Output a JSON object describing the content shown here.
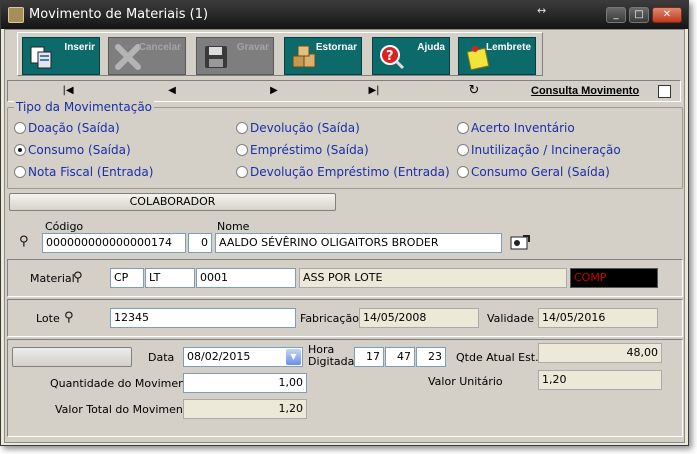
{
  "window": {
    "title": "Movimento de Materiais (1)",
    "resize_glyph": "↔",
    "minimize": "_",
    "maximize": "□",
    "close": "✕"
  },
  "toolbar": [
    {
      "label": "Inserir",
      "icon": "copy-document-icon",
      "enabled": true
    },
    {
      "label": "Cancelar",
      "icon": "cancel-x-icon",
      "enabled": false
    },
    {
      "label": "Gravar",
      "icon": "floppy-disk-icon",
      "enabled": false
    },
    {
      "label": "Estornar",
      "icon": "boxes-icon",
      "enabled": true
    },
    {
      "label": "Ajuda",
      "icon": "help-magnifier-icon",
      "enabled": true
    },
    {
      "label": "Lembrete",
      "icon": "sticky-note-icon",
      "enabled": true
    }
  ],
  "nav": {
    "first": "|◀",
    "prev": "◀",
    "next": "▶",
    "last": "▶|",
    "refresh": "↻",
    "consulta": "Consulta Movimento"
  },
  "tipo": {
    "legend": "Tipo da Movimentação",
    "options": [
      "Doação (Saída)",
      "Devolução (Saída)",
      "Acerto Inventário",
      "Consumo (Saída)",
      "Empréstimo (Saída)",
      "Inutilização / Incineração",
      "Nota Fiscal (Entrada)",
      "Devolução Empréstimo (Entrada)",
      "Consumo Geral (Saída)"
    ],
    "selected": "Consumo (Saída)"
  },
  "colaborador": {
    "section_label": "COLABORADOR",
    "codigo_label": "Código",
    "codigo": "000000000000000174",
    "codigo_digit": "0",
    "nome_label": "Nome",
    "nome": "AALDO SÉVÊRINO OLIGAITORS BRODER"
  },
  "material": {
    "label": "Material",
    "f1": "CP",
    "f2": "LT",
    "f3": "0001",
    "descricao": "ASS POR LOTE",
    "tag": "COMP"
  },
  "lote": {
    "label": "Lote",
    "value": "12345",
    "fabricacao_label": "Fabricação",
    "fabricacao": "14/05/2008",
    "validade_label": "Validade",
    "validade": "14/05/2016"
  },
  "movimento": {
    "data_label": "Data",
    "data": "08/02/2015",
    "hora_label_1": "Hora",
    "hora_label_2": "Digitada",
    "hora": "17",
    "minuto": "47",
    "segundo": "23",
    "qtde_label": "Qtde Atual Est.",
    "qtde": "48,00",
    "quantidade_label": "Quantidade do Movimento",
    "quantidade": "1,00",
    "valor_unit_label": "Valor Unitário",
    "valor_unit": "1,20",
    "valor_total_label": "Valor Total do Movimento",
    "valor_total": "1,20"
  },
  "colors": {
    "accent_teal": "#0d6a6a",
    "radio_text": "#1a2ea8",
    "tag_red": "#cc0000"
  }
}
